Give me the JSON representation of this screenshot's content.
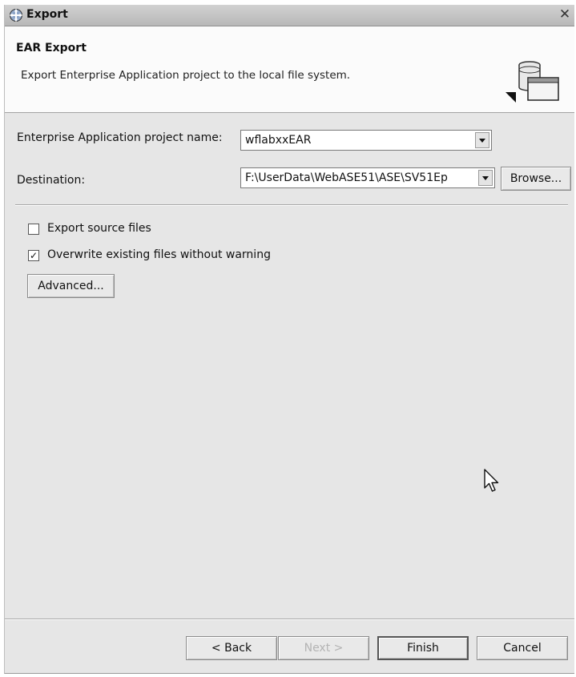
{
  "window": {
    "title": "Export"
  },
  "header": {
    "title": "EAR Export",
    "description": "Export Enterprise Application project to the local file system."
  },
  "form": {
    "project_label": "Enterprise Application project name:",
    "project_value": "wflabxxEAR",
    "destination_label": "Destination:",
    "destination_value": "F:\\UserData\\WebASE51\\ASE\\SV51Ep",
    "browse_label": "Browse..."
  },
  "options": {
    "export_source": {
      "label": "Export source files",
      "checked": false
    },
    "overwrite": {
      "label": "Overwrite existing files without warning",
      "checked": true
    },
    "advanced_label": "Advanced..."
  },
  "footer": {
    "back_label": "< Back",
    "next_label": "Next >",
    "finish_label": "Finish",
    "cancel_label": "Cancel"
  },
  "icons": {
    "title": "export-globe-icon",
    "close": "close-icon",
    "wizard": "ear-export-wizard-icon"
  }
}
